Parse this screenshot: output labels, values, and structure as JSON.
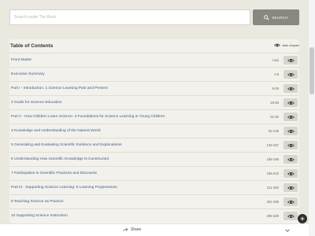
{
  "search": {
    "placeholder": "Search inside The Book",
    "button_label": "SEARCH"
  },
  "toc": {
    "title": "Table of Contents",
    "slides_toggle_label": "slide chapter",
    "rows": [
      {
        "label": "Front Matter",
        "pages": "i-xxii"
      },
      {
        "label": "Executive Summary",
        "pages": "1-8"
      },
      {
        "label": "Part I - Introduction: 1 Science Learning Past and Present",
        "pages": "9-25"
      },
      {
        "label": "2 Goals for Science Education",
        "pages": "26-50"
      },
      {
        "label": "Part II - How Children Learn Science: 3 Foundations for Science Learning in Young Children",
        "pages": "51-92"
      },
      {
        "label": "4 Knowledge and Understanding of the Natural World",
        "pages": "93-128"
      },
      {
        "label": "5 Generating and Evaluating Scientific Evidence and Explanations",
        "pages": "129-167"
      },
      {
        "label": "6 Understanding How Scientific Knowledge Is Constructed",
        "pages": "168-185"
      },
      {
        "label": "7 Participation in Scientific Practices and Discourse",
        "pages": "186-210"
      },
      {
        "label": "Part III - Supporting Science Learning: 8 Learning Progressions",
        "pages": "211-250"
      },
      {
        "label": "9 Teaching Science as Practice",
        "pages": "251-295"
      },
      {
        "label": "10 Supporting Science Instruction",
        "pages": "296-330"
      }
    ]
  },
  "bottom_bar": {
    "share_label": "Share"
  },
  "icons": {
    "search": "magnifier-icon",
    "view": "eye-icon",
    "share": "share-arrow-icon",
    "chevron": "chevron-down-icon",
    "add": "plus-icon"
  }
}
